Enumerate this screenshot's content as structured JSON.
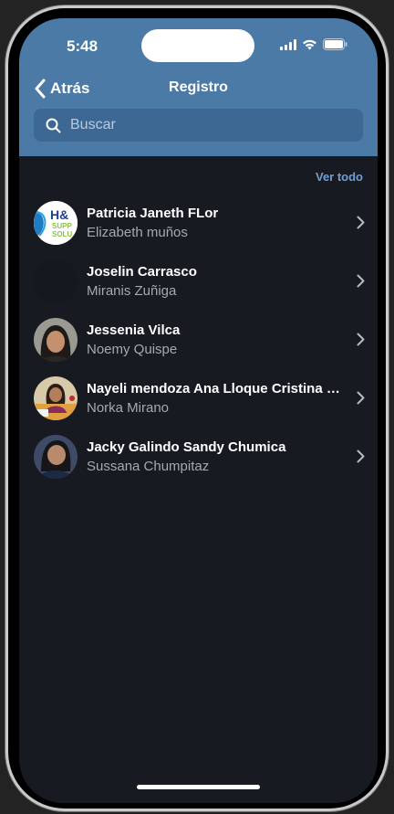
{
  "status": {
    "time": "5:48"
  },
  "nav": {
    "back_label": "Atrás",
    "title": "Registro"
  },
  "search": {
    "placeholder": "Buscar"
  },
  "list": {
    "see_all_label": "Ver todo",
    "items": [
      {
        "title": "Patricia Janeth FLor",
        "subtitle": "Elizabeth muños",
        "avatar_text_top": "H&",
        "avatar_text_mid": "SUPP",
        "avatar_text_bot": "SOLU"
      },
      {
        "title": "Joselin Carrasco",
        "subtitle": "Miranis Zuñiga"
      },
      {
        "title": "Jessenia Vilca",
        "subtitle": "Noemy Quispe"
      },
      {
        "title": "Nayeli mendoza Ana Lloque Cristina Huaman",
        "subtitle": "Norka Mirano"
      },
      {
        "title": "Jacky Galindo Sandy Chumica",
        "subtitle": "Sussana Chumpitaz"
      }
    ]
  },
  "colors": {
    "header": "#4a7aa5",
    "background": "#171a21",
    "accent": "#6ea0d6"
  }
}
